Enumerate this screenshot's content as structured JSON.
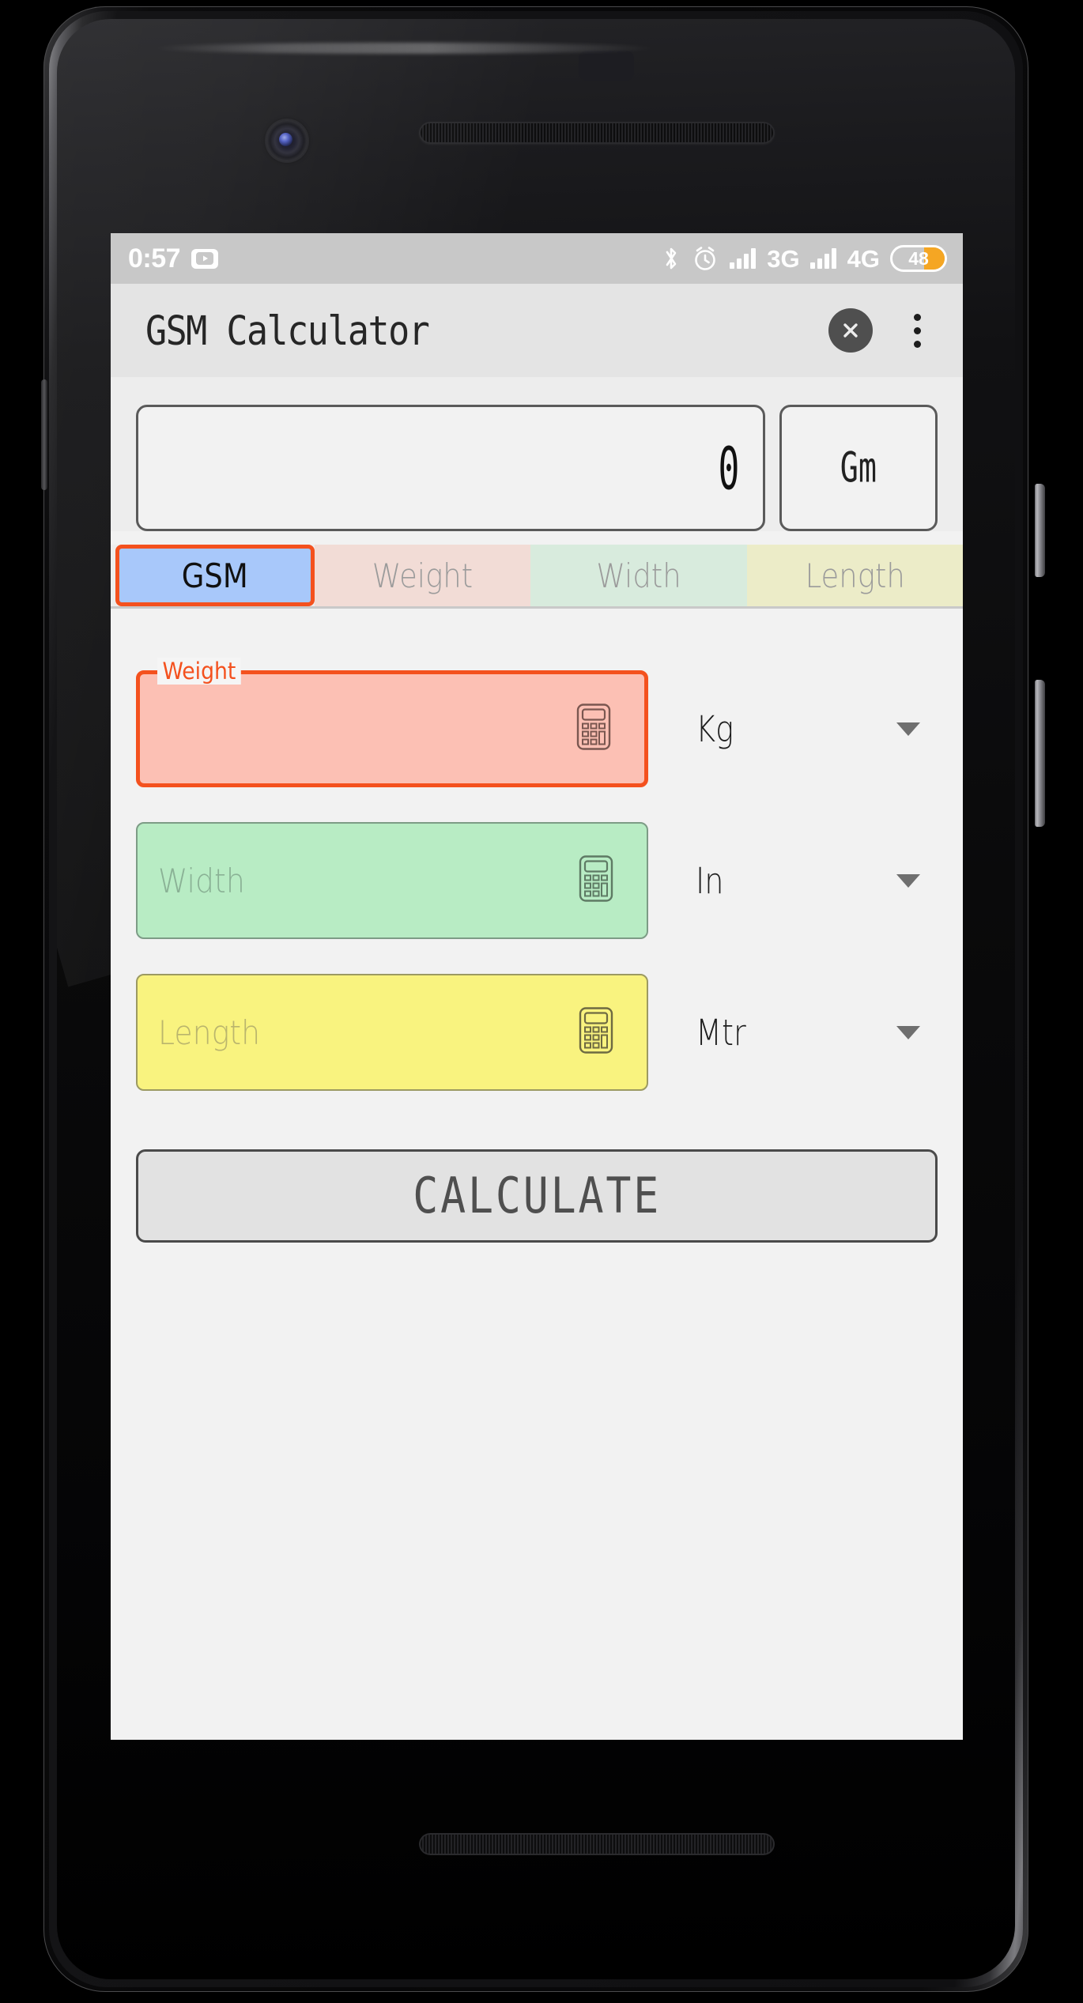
{
  "statusbar": {
    "clock": "0:57",
    "youtube_icon": "youtube-icon",
    "bluetooth_icon": "bluetooth-icon",
    "alarm_icon": "alarm-clock-icon",
    "sim1_label": "3G",
    "sim2_label": "4G",
    "battery_level": "48"
  },
  "appbar": {
    "title": "GSM Calculator",
    "close_icon": "close-icon",
    "overflow_icon": "more-vertical-icon"
  },
  "result": {
    "value": "0",
    "unit": "Gm"
  },
  "tabs": [
    {
      "label": "GSM",
      "selected": true
    },
    {
      "label": "Weight",
      "selected": false
    },
    {
      "label": "Width",
      "selected": false
    },
    {
      "label": "Length",
      "selected": false
    }
  ],
  "fields": [
    {
      "name": "weight",
      "float_label": "Weight",
      "placeholder": "",
      "value": "",
      "unit": "Kg",
      "icon": "calculator-icon"
    },
    {
      "name": "width",
      "float_label": "",
      "placeholder": "Width",
      "value": "",
      "unit": "In",
      "icon": "calculator-icon"
    },
    {
      "name": "length",
      "float_label": "",
      "placeholder": "Length",
      "value": "",
      "unit": "Mtr",
      "icon": "calculator-icon"
    }
  ],
  "calculate_button": {
    "label": "CALCULATE"
  },
  "colors": {
    "accent_orange": "#f4511e",
    "tab_selected_blue": "#a8c8fa",
    "tab_weight_pink": "#f2dcd6",
    "tab_width_green": "#d8ebdd",
    "tab_length_yellow": "#ececc8",
    "field_weight_pink": "#fcc0b4",
    "field_width_green": "#b8ecc4",
    "field_length_yellow": "#f9f37f",
    "battery_orange": "#f5a623",
    "statusbar_gray": "#c8c8c8",
    "appbar_gray": "#e4e4e4"
  }
}
